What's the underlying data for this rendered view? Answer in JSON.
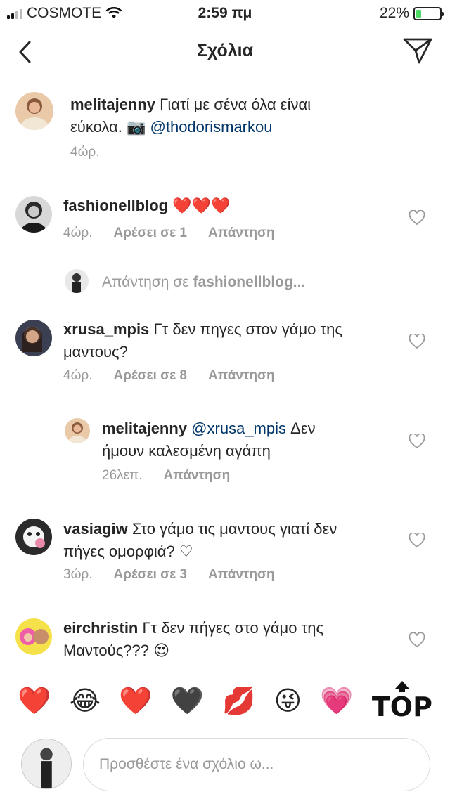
{
  "status_bar": {
    "carrier": "COSMOTE",
    "time": "2:59 πμ",
    "battery": "22%",
    "battery_level": 0.22
  },
  "header": {
    "title": "Σχόλια",
    "back_icon": "chevron-left-icon",
    "send_icon": "paper-plane-icon"
  },
  "caption": {
    "username": "melitajenny",
    "text": "Γιατί με σένα όλα είναι εύκολα. 📷",
    "mention": "@thodorismarkou",
    "time": "4ώρ."
  },
  "comments": [
    {
      "username": "fashionellblog",
      "text": "❤️❤️❤️",
      "time": "4ώρ.",
      "likes": "Αρέσει σε 1",
      "reply": "Απάντηση"
    },
    {
      "reply_prompt": "Απάντηση σε",
      "reply_prompt_user": "fashionellblog...",
      "username": "xrusa_mpis",
      "text_line1": "Γτ δεν πηγες στον γάμο της",
      "text_line2": "μαντους?",
      "time": "4ώρ.",
      "likes": "Αρέσει σε 8",
      "reply": "Απάντηση"
    },
    {
      "username": "melitajenny",
      "mention": "@xrusa_mpis",
      "text_line1": "Δεν",
      "text_line2": "ήμουν καλεσμένη αγάπη",
      "time": "26λεπ.",
      "reply": "Απάντηση"
    },
    {
      "username": "vasiagiw",
      "text_line1": "Στο γάμο τις μαντους γιατί δεν",
      "text_line2": "πήγες ομορφιά? ♡",
      "time": "3ώρ.",
      "likes": "Αρέσει σε 3",
      "reply": "Απάντηση"
    },
    {
      "username": "eirchristin",
      "text_line1": "Γτ δεν πήγες στο γάμο της",
      "text_line2": "Μαντούς??? 😍",
      "time": "",
      "likes": "",
      "reply": ""
    }
  ],
  "reactions": [
    "❤️",
    "😂",
    "❤️",
    "🖤",
    "💋",
    "😜",
    "💗"
  ],
  "top_button": "TOP",
  "input": {
    "placeholder": "Προσθέστε ένα σχόλιο ω..."
  }
}
